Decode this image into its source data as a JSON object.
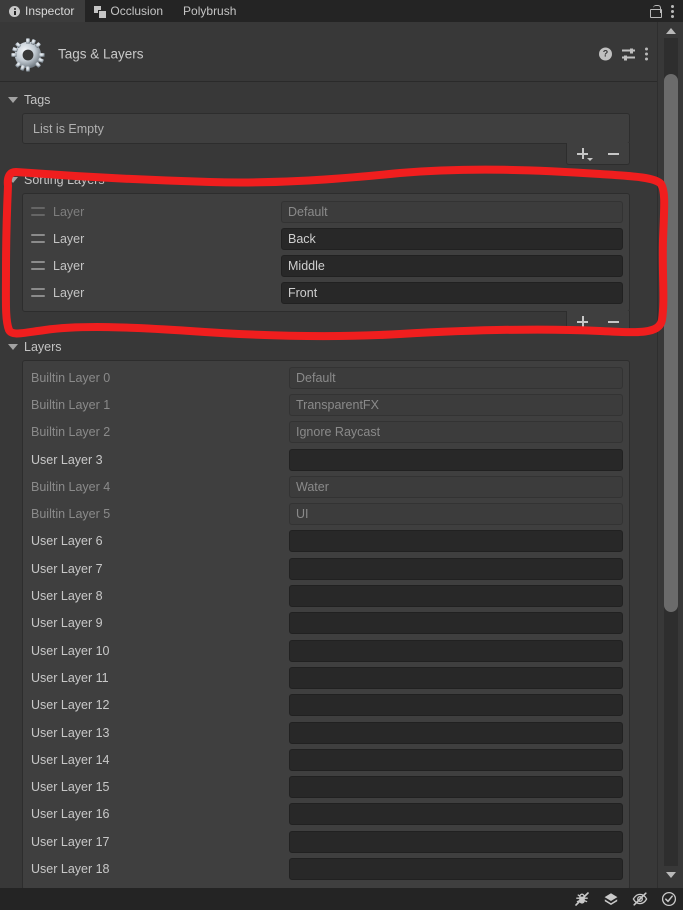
{
  "window": {
    "tabs": [
      {
        "label": "Inspector",
        "icon": "info-icon",
        "active": true
      },
      {
        "label": "Occlusion",
        "icon": "occlusion-icon",
        "active": false
      },
      {
        "label": "Polybrush",
        "icon": "",
        "active": false
      }
    ],
    "lock_icon": "lock-open-icon",
    "menu_icon": "kebab-menu-icon"
  },
  "component": {
    "icon": "gear-icon",
    "title": "Tags & Layers",
    "help_icon": "help-icon",
    "help_glyph": "?",
    "preset_icon": "preset-settings-icon",
    "menu_icon": "kebab-menu-icon"
  },
  "tags": {
    "foldout_label": "Tags",
    "expanded": true,
    "empty_text": "List is Empty",
    "add_label": "+",
    "remove_label": "−",
    "add_has_dropdown": true
  },
  "sorting_layers": {
    "foldout_label": "Sorting Layers",
    "expanded": true,
    "rows": [
      {
        "label": "Layer",
        "value": "Default",
        "disabled": true
      },
      {
        "label": "Layer",
        "value": "Back",
        "disabled": false
      },
      {
        "label": "Layer",
        "value": "Middle",
        "disabled": false
      },
      {
        "label": "Layer",
        "value": "Front",
        "disabled": false
      }
    ],
    "add_label": "+",
    "remove_label": "−",
    "add_has_dropdown": false
  },
  "layers": {
    "foldout_label": "Layers",
    "expanded": true,
    "rows": [
      {
        "label": "Builtin Layer 0",
        "value": "Default",
        "builtin": true
      },
      {
        "label": "Builtin Layer 1",
        "value": "TransparentFX",
        "builtin": true
      },
      {
        "label": "Builtin Layer 2",
        "value": "Ignore Raycast",
        "builtin": true
      },
      {
        "label": "User Layer 3",
        "value": "",
        "builtin": false
      },
      {
        "label": "Builtin Layer 4",
        "value": "Water",
        "builtin": true
      },
      {
        "label": "Builtin Layer 5",
        "value": "UI",
        "builtin": true
      },
      {
        "label": "User Layer 6",
        "value": "",
        "builtin": false
      },
      {
        "label": "User Layer 7",
        "value": "",
        "builtin": false
      },
      {
        "label": "User Layer 8",
        "value": "",
        "builtin": false
      },
      {
        "label": "User Layer 9",
        "value": "",
        "builtin": false
      },
      {
        "label": "User Layer 10",
        "value": "",
        "builtin": false
      },
      {
        "label": "User Layer 11",
        "value": "",
        "builtin": false
      },
      {
        "label": "User Layer 12",
        "value": "",
        "builtin": false
      },
      {
        "label": "User Layer 13",
        "value": "",
        "builtin": false
      },
      {
        "label": "User Layer 14",
        "value": "",
        "builtin": false
      },
      {
        "label": "User Layer 15",
        "value": "",
        "builtin": false
      },
      {
        "label": "User Layer 16",
        "value": "",
        "builtin": false
      },
      {
        "label": "User Layer 17",
        "value": "",
        "builtin": false
      },
      {
        "label": "User Layer 18",
        "value": "",
        "builtin": false
      }
    ]
  },
  "scrollbar": {
    "up_icon": "scroll-up-arrow-icon",
    "down_icon": "scroll-down-arrow-icon"
  },
  "statusbar": {
    "icons": [
      "mute-bug-icon",
      "collab-cloud-icon",
      "eye-off-icon",
      "check-circle-icon"
    ]
  },
  "annotation": {
    "type": "freehand-rectangle",
    "color": "#f01e1e",
    "target": "Sorting Layers section"
  },
  "theme": {
    "panel_bg": "#383838",
    "tabbar_bg": "#242424",
    "field_bg": "#282828",
    "field_disabled_bg": "#3c3c3c",
    "listbox_bg": "#3f3f3f",
    "text": "#c8c8c8",
    "text_dim": "#8a8a8a",
    "annotation": "#f01e1e"
  }
}
